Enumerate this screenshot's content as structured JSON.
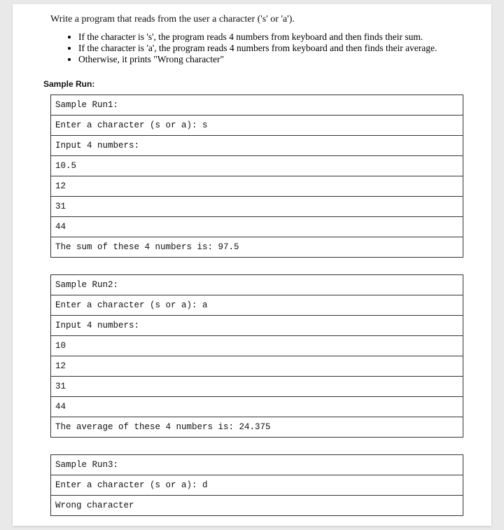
{
  "intro": "Write a program that reads from the user a character ('s' or 'a').",
  "bullets": [
    "If the character is 's', the program reads 4 numbers from keyboard and then finds their sum.",
    "If the character is 'a', the program reads 4 numbers from keyboard and then finds their average.",
    "Otherwise, it prints \"Wrong character\""
  ],
  "sample_heading": "Sample Run:",
  "run1": {
    "title": "Sample Run1:",
    "prompt": "Enter a character (s or a): s",
    "input_label": "Input 4 numbers:",
    "n1": "10.5",
    "n2": "12",
    "n3": "31",
    "n4": "44",
    "result": "The sum of these 4 numbers is: 97.5"
  },
  "run2": {
    "title": "Sample Run2:",
    "prompt": "Enter a character (s or a): a",
    "input_label": "Input 4 numbers:",
    "n1": "10",
    "n2": "12",
    "n3": "31",
    "n4": "44",
    "result": "The average of these 4 numbers is: 24.375"
  },
  "run3": {
    "title": "Sample Run3:",
    "prompt": "Enter a character (s or a): d",
    "result": "Wrong character"
  }
}
